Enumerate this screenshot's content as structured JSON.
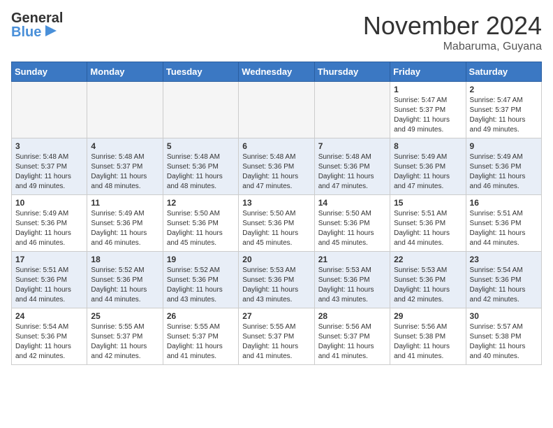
{
  "header": {
    "logo_line1": "General",
    "logo_line2": "Blue",
    "month": "November 2024",
    "location": "Mabaruma, Guyana"
  },
  "days_of_week": [
    "Sunday",
    "Monday",
    "Tuesday",
    "Wednesday",
    "Thursday",
    "Friday",
    "Saturday"
  ],
  "weeks": [
    [
      {
        "day": "",
        "info": ""
      },
      {
        "day": "",
        "info": ""
      },
      {
        "day": "",
        "info": ""
      },
      {
        "day": "",
        "info": ""
      },
      {
        "day": "",
        "info": ""
      },
      {
        "day": "1",
        "info": "Sunrise: 5:47 AM\nSunset: 5:37 PM\nDaylight: 11 hours\nand 49 minutes."
      },
      {
        "day": "2",
        "info": "Sunrise: 5:47 AM\nSunset: 5:37 PM\nDaylight: 11 hours\nand 49 minutes."
      }
    ],
    [
      {
        "day": "3",
        "info": "Sunrise: 5:48 AM\nSunset: 5:37 PM\nDaylight: 11 hours\nand 49 minutes."
      },
      {
        "day": "4",
        "info": "Sunrise: 5:48 AM\nSunset: 5:37 PM\nDaylight: 11 hours\nand 48 minutes."
      },
      {
        "day": "5",
        "info": "Sunrise: 5:48 AM\nSunset: 5:36 PM\nDaylight: 11 hours\nand 48 minutes."
      },
      {
        "day": "6",
        "info": "Sunrise: 5:48 AM\nSunset: 5:36 PM\nDaylight: 11 hours\nand 47 minutes."
      },
      {
        "day": "7",
        "info": "Sunrise: 5:48 AM\nSunset: 5:36 PM\nDaylight: 11 hours\nand 47 minutes."
      },
      {
        "day": "8",
        "info": "Sunrise: 5:49 AM\nSunset: 5:36 PM\nDaylight: 11 hours\nand 47 minutes."
      },
      {
        "day": "9",
        "info": "Sunrise: 5:49 AM\nSunset: 5:36 PM\nDaylight: 11 hours\nand 46 minutes."
      }
    ],
    [
      {
        "day": "10",
        "info": "Sunrise: 5:49 AM\nSunset: 5:36 PM\nDaylight: 11 hours\nand 46 minutes."
      },
      {
        "day": "11",
        "info": "Sunrise: 5:49 AM\nSunset: 5:36 PM\nDaylight: 11 hours\nand 46 minutes."
      },
      {
        "day": "12",
        "info": "Sunrise: 5:50 AM\nSunset: 5:36 PM\nDaylight: 11 hours\nand 45 minutes."
      },
      {
        "day": "13",
        "info": "Sunrise: 5:50 AM\nSunset: 5:36 PM\nDaylight: 11 hours\nand 45 minutes."
      },
      {
        "day": "14",
        "info": "Sunrise: 5:50 AM\nSunset: 5:36 PM\nDaylight: 11 hours\nand 45 minutes."
      },
      {
        "day": "15",
        "info": "Sunrise: 5:51 AM\nSunset: 5:36 PM\nDaylight: 11 hours\nand 44 minutes."
      },
      {
        "day": "16",
        "info": "Sunrise: 5:51 AM\nSunset: 5:36 PM\nDaylight: 11 hours\nand 44 minutes."
      }
    ],
    [
      {
        "day": "17",
        "info": "Sunrise: 5:51 AM\nSunset: 5:36 PM\nDaylight: 11 hours\nand 44 minutes."
      },
      {
        "day": "18",
        "info": "Sunrise: 5:52 AM\nSunset: 5:36 PM\nDaylight: 11 hours\nand 44 minutes."
      },
      {
        "day": "19",
        "info": "Sunrise: 5:52 AM\nSunset: 5:36 PM\nDaylight: 11 hours\nand 43 minutes."
      },
      {
        "day": "20",
        "info": "Sunrise: 5:53 AM\nSunset: 5:36 PM\nDaylight: 11 hours\nand 43 minutes."
      },
      {
        "day": "21",
        "info": "Sunrise: 5:53 AM\nSunset: 5:36 PM\nDaylight: 11 hours\nand 43 minutes."
      },
      {
        "day": "22",
        "info": "Sunrise: 5:53 AM\nSunset: 5:36 PM\nDaylight: 11 hours\nand 42 minutes."
      },
      {
        "day": "23",
        "info": "Sunrise: 5:54 AM\nSunset: 5:36 PM\nDaylight: 11 hours\nand 42 minutes."
      }
    ],
    [
      {
        "day": "24",
        "info": "Sunrise: 5:54 AM\nSunset: 5:36 PM\nDaylight: 11 hours\nand 42 minutes."
      },
      {
        "day": "25",
        "info": "Sunrise: 5:55 AM\nSunset: 5:37 PM\nDaylight: 11 hours\nand 42 minutes."
      },
      {
        "day": "26",
        "info": "Sunrise: 5:55 AM\nSunset: 5:37 PM\nDaylight: 11 hours\nand 41 minutes."
      },
      {
        "day": "27",
        "info": "Sunrise: 5:55 AM\nSunset: 5:37 PM\nDaylight: 11 hours\nand 41 minutes."
      },
      {
        "day": "28",
        "info": "Sunrise: 5:56 AM\nSunset: 5:37 PM\nDaylight: 11 hours\nand 41 minutes."
      },
      {
        "day": "29",
        "info": "Sunrise: 5:56 AM\nSunset: 5:38 PM\nDaylight: 11 hours\nand 41 minutes."
      },
      {
        "day": "30",
        "info": "Sunrise: 5:57 AM\nSunset: 5:38 PM\nDaylight: 11 hours\nand 40 minutes."
      }
    ]
  ]
}
